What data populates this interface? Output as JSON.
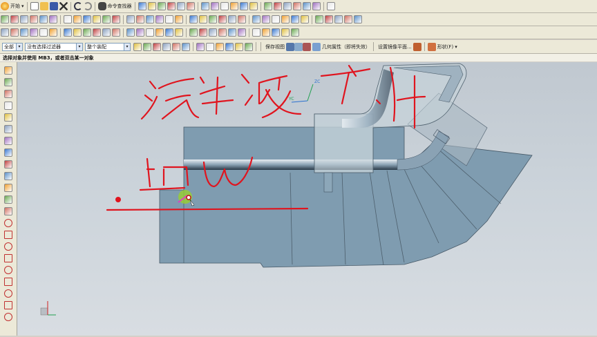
{
  "toolbar1": {
    "start_label": "开始",
    "start_arrow": "▾",
    "command_finder_label": "命令查找器",
    "icons": [
      "ug-logo-icon",
      "new-file-icon",
      "open-file-icon",
      "save-icon",
      "close-icon",
      "undo-icon",
      "redo-icon",
      "binoculars-icon",
      "select-icon",
      "snap-icon",
      "layers-icon",
      "fit-icon",
      "zoom-icon",
      "rotate-icon",
      "pan-icon",
      "render-icon",
      "cube-view-icon",
      "iso-view-icon",
      "front-view-icon",
      "top-view-icon",
      "wcs-icon",
      "palette-icon",
      "layout-icon",
      "part-nav-icon",
      "tools-icon",
      "analysis-icon"
    ]
  },
  "toolbar2": {
    "icons": [
      "sketch-icon",
      "datum-plane-icon",
      "extrude-icon",
      "revolve-icon",
      "hole-icon",
      "block-icon",
      "cylinder-icon",
      "cone-icon",
      "sphere-icon",
      "pad-icon",
      "pocket-icon",
      "boss-icon",
      "blend-icon",
      "chamfer-icon",
      "shell-icon",
      "draft-icon",
      "trim-icon",
      "split-icon",
      "pattern-icon",
      "mirror-icon",
      "unite-icon",
      "subtract-icon",
      "intersect-icon",
      "thicken-icon",
      "offset-icon",
      "sew-icon",
      "patch-icon",
      "replace-icon",
      "move-face-icon",
      "delete-face-icon",
      "resize-icon",
      "measure-icon",
      "section-icon",
      "color-icon",
      "wave-icon"
    ]
  },
  "toolbar3": {
    "icons": [
      "point-icon",
      "line-icon",
      "arc-icon",
      "circle-icon",
      "spline-icon",
      "rectangle-icon",
      "polygon-icon",
      "text-icon",
      "helix-icon",
      "offset-curve-icon",
      "project-icon",
      "intersect-curve-icon",
      "bridge-icon",
      "join-icon",
      "trim-curve-icon",
      "divide-icon",
      "through-curves-icon",
      "mesh-icon",
      "swept-icon",
      "ruled-icon",
      "extension-icon",
      "law-icon",
      "blend-surface-icon",
      "n-sided-icon",
      "studio-icon",
      "face-blend-icon",
      "offset-face-icon",
      "trimmed-sheet-icon",
      "enlarge-icon"
    ]
  },
  "toolbar4": {
    "filter_value": "全部",
    "filter_options_label": "没有选择过滤器",
    "assembly_value": "整个装配",
    "save_view_label": "保存视图",
    "geometry_property_label": "几何属性（即将失效）",
    "mirror_plane_label": "设置镜像平面...",
    "shape_label": "形状(F)",
    "shape_arrow": "▾"
  },
  "status_text": "选择对象并使用 MB3，或者双击某一对象",
  "leftbar_icons": [
    "role-icon",
    "line-tool-icon",
    "assembly-nav-icon",
    "constraint-icon",
    "part-icon",
    "history-icon",
    "reuse-icon",
    "web-icon",
    "hd3d-icon",
    "clock-icon",
    "process-icon",
    "palette-side-icon",
    "system-icon",
    "arc-tool-icon",
    "fillet-tool-icon",
    "corner-tool-icon",
    "profile-tool-icon",
    "circle-tool-icon",
    "point-tool-icon",
    "dim-tool-icon",
    "coord-tool-icon",
    "constraint-tool-icon"
  ],
  "viewport": {
    "model_color": "#7f9cb0",
    "annotation_color": "#e0141e",
    "axis_labels": {
      "xc": "XC",
      "yc": "YC",
      "zc": "ZC"
    },
    "annotations": [
      "handwritten-car-design-text",
      "handwritten-law-text"
    ]
  }
}
